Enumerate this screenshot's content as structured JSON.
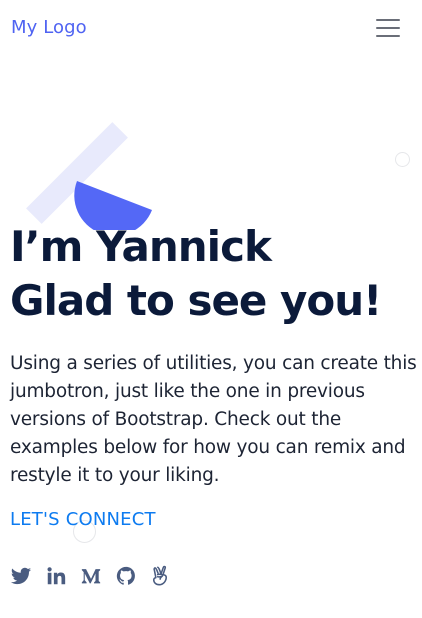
{
  "navbar": {
    "logo_text": "My Logo",
    "menu_icon": "hamburger-menu-icon"
  },
  "hero": {
    "title_line1": "I’m Yannick",
    "title_line2": "Glad to see you!",
    "lead": "Using a series of utilities, you can create this jumbotron, just like the one in previous versions of Bootstrap. Check out the examples below for how you can remix and restyle it to your liking.",
    "cta_label": "LET'S CONNECT"
  },
  "social": {
    "icons": [
      "twitter-icon",
      "linkedin-icon",
      "medium-icon",
      "github-icon",
      "angellist-icon"
    ]
  },
  "colors": {
    "logo": "#4f63f2",
    "title": "#0b1a3a",
    "cta": "#0d7bf0",
    "social_icon": "#4a5c80",
    "deco_half_circle": "#5468f6",
    "deco_bar": "#e8eafc"
  }
}
